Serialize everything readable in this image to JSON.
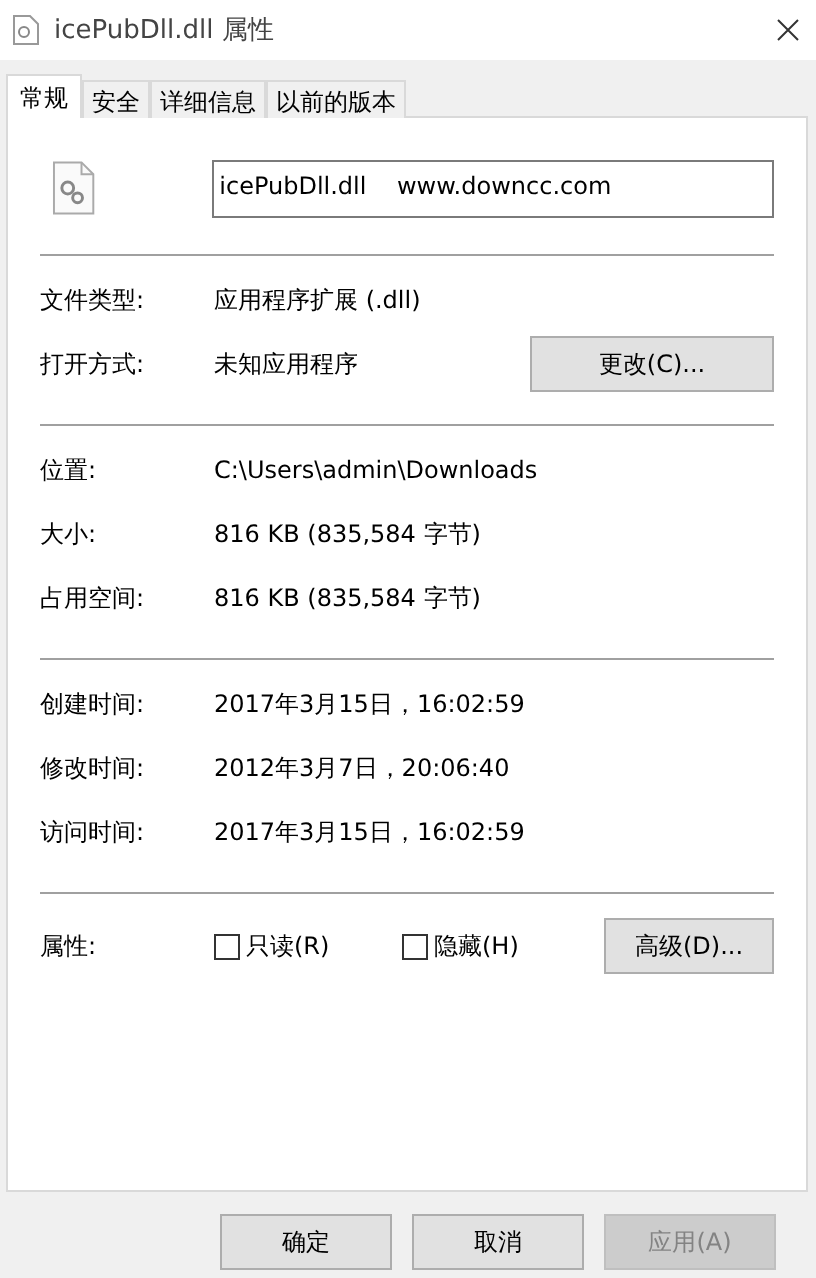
{
  "window": {
    "title": "icePubDll.dll 属性"
  },
  "tabs": [
    {
      "label": "常规",
      "selected": true
    },
    {
      "label": "安全",
      "selected": false
    },
    {
      "label": "详细信息",
      "selected": false
    },
    {
      "label": "以前的版本",
      "selected": false
    }
  ],
  "file_name": {
    "value": "icePubDll.dll    www.downcc.com"
  },
  "sections": [
    {
      "rows": [
        {
          "label": "文件类型:",
          "value": "应用程序扩展 (.dll)"
        },
        {
          "label": "打开方式:",
          "value": "未知应用程序",
          "button": "更改(C)..."
        }
      ]
    },
    {
      "rows": [
        {
          "label": "位置:",
          "value": "C:\\Users\\admin\\Downloads"
        },
        {
          "label": "大小:",
          "value": "816 KB (835,584 字节)"
        },
        {
          "label": "占用空间:",
          "value": "816 KB (835,584 字节)"
        }
      ]
    },
    {
      "rows": [
        {
          "label": "创建时间:",
          "value": "2017年3月15日，16:02:59"
        },
        {
          "label": "修改时间:",
          "value": "2012年3月7日，20:06:40"
        },
        {
          "label": "访问时间:",
          "value": "2017年3月15日，16:02:59"
        }
      ]
    }
  ],
  "attributes": {
    "label": "属性:",
    "checkboxes": [
      {
        "label": "只读(R)",
        "checked": false
      },
      {
        "label": "隐藏(H)",
        "checked": false
      }
    ],
    "button": "高级(D)..."
  },
  "buttons": [
    {
      "label": "确定",
      "disabled": false
    },
    {
      "label": "取消",
      "disabled": false
    },
    {
      "label": "应用(A)",
      "disabled": true
    }
  ]
}
